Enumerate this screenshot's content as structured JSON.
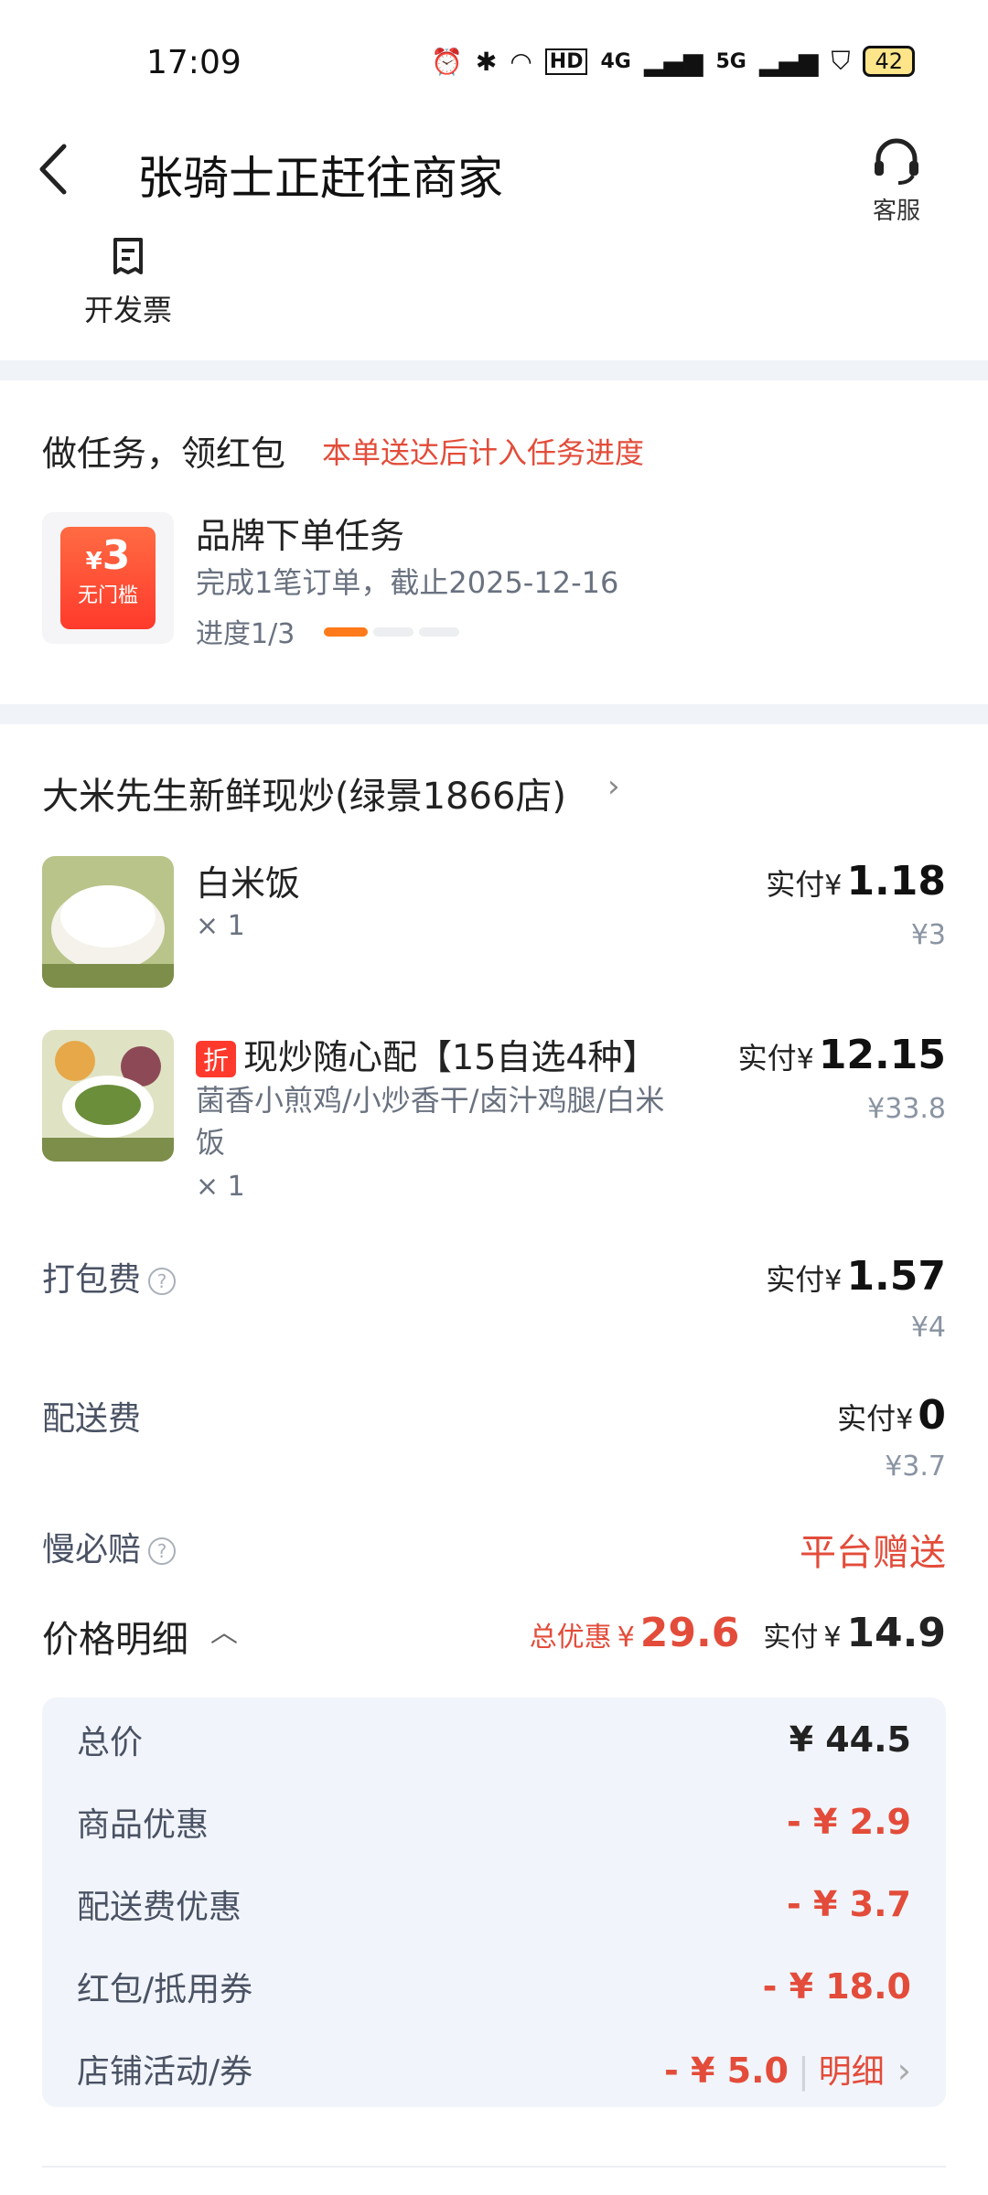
{
  "status_bar": {
    "time": "17:09",
    "network_labels": [
      "HD",
      "4G",
      "5G"
    ],
    "battery": "42"
  },
  "header": {
    "title": "张骑士正赶往商家",
    "customer_service": "客服",
    "invoice": "开发票"
  },
  "task": {
    "title": "做任务，领红包",
    "note": "本单送达后计入任务进度",
    "coupon_currency": "¥",
    "coupon_amount": "3",
    "coupon_caption": "无门槛",
    "name": "品牌下单任务",
    "desc": "完成1笔订单，截止2025-12-16",
    "progress_text": "进度1/3",
    "progress": 0.33
  },
  "store": {
    "name": "大米先生新鲜现炒(绿景1866店)",
    "items": [
      {
        "name": "白米饭",
        "qty": "× 1",
        "pay_label": "实付",
        "currency": "¥",
        "price": "1.18",
        "original": "¥3",
        "discount_tag": "",
        "desc": ""
      },
      {
        "name": "现炒随心配【15自选4种】",
        "qty": "× 1",
        "pay_label": "实付",
        "currency": "¥",
        "price": "12.15",
        "original": "¥33.8",
        "discount_tag": "折",
        "desc": "菌香小煎鸡/小炒香干/卤汁鸡腿/白米饭"
      }
    ]
  },
  "fees": {
    "packing_label": "打包费",
    "packing_pay_label": "实付",
    "packing_currency": "¥",
    "packing_price": "1.57",
    "packing_original": "¥4",
    "delivery_label": "配送费",
    "delivery_pay_label": "实付",
    "delivery_currency": "¥",
    "delivery_price": "0",
    "delivery_original": "¥3.7",
    "late_label": "慢必赔",
    "late_value": "平台赠送"
  },
  "price_detail": {
    "label": "价格明细",
    "total_discount_label": "总优惠",
    "total_discount_currency": "¥",
    "total_discount": "29.6",
    "pay_label": "实付",
    "pay_currency": "¥",
    "pay_total": "14.9",
    "rows": [
      {
        "label": "总价",
        "value": "¥ 44.5"
      },
      {
        "label": "商品优惠",
        "value": "- ¥ 2.9"
      },
      {
        "label": "配送费优惠",
        "value": "- ¥ 3.7"
      },
      {
        "label": "红包/抵用券",
        "value": "- ¥ 18.0"
      },
      {
        "label": "店铺活动/券",
        "value": "- ¥ 5.0"
      }
    ],
    "detail_link": "明细"
  },
  "colors": {
    "accent_red": "#e34c3a",
    "progress_orange": "#ff7a1a",
    "panel_bg": "#f1f5fb"
  }
}
